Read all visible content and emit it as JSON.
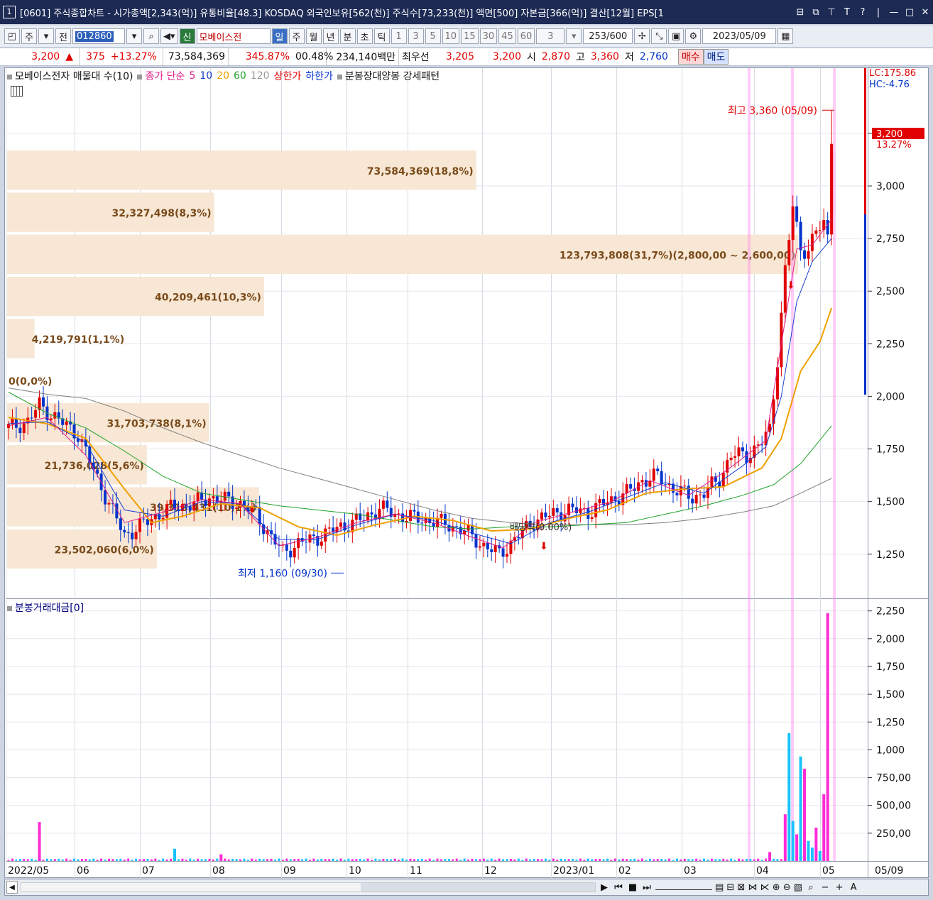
{
  "window": {
    "number": "1",
    "title": "[0601] 주식종합차트 - 시가총액[2,343(억)] 유통비율[48.3] KOSDAQ 외국인보유[562(천)] 주식수[73,233(천)] 액면[500] 자본금[366(억)] 결산[12월] EPS[1",
    "buttons": [
      "⊟",
      "⧉",
      "⊤",
      "T",
      "?",
      "|",
      "—",
      "□",
      "✕"
    ]
  },
  "toolbar": {
    "type_selector": "주",
    "all_label": "전",
    "stock_code": "012860",
    "new_badge": "신",
    "stock_name": "모베이스전",
    "period_tabs": [
      "일",
      "주",
      "월",
      "년",
      "분",
      "초",
      "틱"
    ],
    "minute_options": [
      "1",
      "3",
      "5",
      "10",
      "15",
      "30",
      "45",
      "60"
    ],
    "interval_value": "3",
    "count_display": "253/600",
    "date_value": "2023/05/09"
  },
  "quote": {
    "price": "3,200",
    "arrow": "▲",
    "change": "375",
    "change_pct": "+13.27%",
    "volume": "73,584,369",
    "volume_ratio": "345.87%",
    "turnover": "00.48%",
    "amount": "234,140백만",
    "best_ask_label": "최우선",
    "best_ask": "3,205",
    "best_bid": "3,200",
    "open_label": "시",
    "open": "2,870",
    "high_label": "고",
    "high": "3,360",
    "low_label": "저",
    "low": "2,760",
    "buy_label": "매수",
    "sell_label": "매도"
  },
  "legend": {
    "profile_label": "모베이스전자 매물대 수(10)",
    "ma_label": "종가 단순",
    "ma_periods": [
      "5",
      "10",
      "20",
      "60",
      "120"
    ],
    "upper_limit": "상한가",
    "lower_limit": "하한가",
    "pattern": "분봉장대양봉 강세패턴"
  },
  "colors": {
    "up": "#e00000",
    "down": "#0033cc",
    "ma5": "#e0208a",
    "ma10": "#1a3fcf",
    "ma20": "#f0a000",
    "ma60": "#21a32a",
    "ma120": "#808080",
    "profile": "#f7e7d4",
    "profile_text": "#7a4a1a",
    "vol_up": "#ff2bd6",
    "vol_down": "#19c3ff"
  },
  "side_labels": {
    "lc": "LC:175.86",
    "hc": "HC:-4.76",
    "current_price": "3,200",
    "current_pct": "13.27%"
  },
  "annotations": {
    "high": "최고 3,360 (05/09)",
    "low": "최저 1,160 (09/30)",
    "dividend": "배당락(0.00%)"
  },
  "volume_legend": "분봉거래대금[0]",
  "bottom": {
    "nav_icons": [
      "▶",
      "⏮",
      "■",
      "⏭"
    ],
    "zoom_minus": "−",
    "zoom_plus": "+",
    "font": "A"
  },
  "chart_data": {
    "type": "candlestick",
    "price_axis": {
      "ticks": [
        1250,
        1500,
        1750,
        2000,
        2250,
        2500,
        2750,
        3000,
        3250
      ],
      "tick_labels": [
        "1,250",
        "1,500",
        "1,750",
        "2,000",
        "2,250",
        "2,500",
        "2,750",
        "3,000",
        "3,250"
      ],
      "range": [
        1040,
        3560
      ]
    },
    "volume_axis": {
      "ticks": [
        250,
        500,
        750,
        1000,
        1250,
        1500,
        1750,
        2000,
        2250
      ],
      "tick_labels": [
        "250,00",
        "500,00",
        "750,00",
        "1,000",
        "1,250",
        "1,500",
        "1,750",
        "2,000",
        "2,250"
      ],
      "range": [
        0,
        2350
      ]
    },
    "x_labels": [
      "2022/05",
      "06",
      "07",
      "08",
      "09",
      "10",
      "11",
      "12",
      "2023/01",
      "02",
      "03",
      "04",
      "05",
      "05/09"
    ],
    "volume_profile": [
      {
        "low": 1175,
        "high": 1375,
        "label": "23,502,060(6,0%)",
        "pct": 6.0
      },
      {
        "low": 1375,
        "high": 1575,
        "label": "39,313,431(10,1%)",
        "pct": 10.1
      },
      {
        "low": 1575,
        "high": 1775,
        "label": "21,736,028(5,6%)",
        "pct": 5.6
      },
      {
        "low": 1775,
        "high": 1975,
        "label": "31,703,738(8,1%)",
        "pct": 8.1
      },
      {
        "low": 1975,
        "high": 2175,
        "label": "0(0,0%)",
        "pct": 0
      },
      {
        "low": 2175,
        "high": 2375,
        "label": "4,219,791(1,1%)",
        "pct": 1.1
      },
      {
        "low": 2375,
        "high": 2575,
        "label": "40,209,461(10,3%)",
        "pct": 10.3
      },
      {
        "low": 2575,
        "high": 2775,
        "label": "123,793,808(31,7%)(2,800,00 ~ 2,600,00)",
        "pct": 31.7
      },
      {
        "low": 2775,
        "high": 2975,
        "label": "32,327,498(8,3%)",
        "pct": 8.3
      },
      {
        "low": 2975,
        "high": 3175,
        "label": "73,584,369(18,8%)",
        "pct": 18.8
      }
    ],
    "close_path": [
      [
        0,
        1850
      ],
      [
        5,
        1880
      ],
      [
        8,
        1960
      ],
      [
        12,
        1900
      ],
      [
        18,
        1820
      ],
      [
        22,
        1650
      ],
      [
        26,
        1490
      ],
      [
        30,
        1340
      ],
      [
        34,
        1380
      ],
      [
        37,
        1420
      ],
      [
        42,
        1470
      ],
      [
        48,
        1490
      ],
      [
        52,
        1520
      ],
      [
        55,
        1510
      ],
      [
        60,
        1490
      ],
      [
        64,
        1440
      ],
      [
        68,
        1330
      ],
      [
        71,
        1260
      ],
      [
        75,
        1300
      ],
      [
        80,
        1330
      ],
      [
        86,
        1380
      ],
      [
        92,
        1420
      ],
      [
        96,
        1470
      ],
      [
        100,
        1440
      ],
      [
        105,
        1420
      ],
      [
        109,
        1410
      ],
      [
        114,
        1390
      ],
      [
        118,
        1360
      ],
      [
        123,
        1290
      ],
      [
        127,
        1250
      ],
      [
        131,
        1320
      ],
      [
        136,
        1410
      ],
      [
        141,
        1440
      ],
      [
        145,
        1460
      ],
      [
        150,
        1450
      ],
      [
        155,
        1500
      ],
      [
        160,
        1540
      ],
      [
        164,
        1600
      ],
      [
        168,
        1620
      ],
      [
        172,
        1560
      ],
      [
        177,
        1520
      ],
      [
        180,
        1540
      ],
      [
        184,
        1610
      ],
      [
        187,
        1720
      ],
      [
        191,
        1720
      ],
      [
        195,
        1780
      ],
      [
        197,
        1840
      ],
      [
        199,
        2180
      ],
      [
        201,
        2600
      ],
      [
        203,
        2900
      ],
      [
        205,
        2700
      ],
      [
        207,
        2700
      ],
      [
        209,
        2780
      ],
      [
        211,
        2820
      ],
      [
        212,
        2760
      ],
      [
        213,
        3200
      ]
    ],
    "ma_paths": {
      "ma5": [
        [
          0,
          1860
        ],
        [
          10,
          1900
        ],
        [
          20,
          1720
        ],
        [
          30,
          1400
        ],
        [
          40,
          1450
        ],
        [
          50,
          1510
        ],
        [
          60,
          1490
        ],
        [
          70,
          1290
        ],
        [
          80,
          1330
        ],
        [
          90,
          1400
        ],
        [
          100,
          1440
        ],
        [
          110,
          1400
        ],
        [
          120,
          1330
        ],
        [
          128,
          1280
        ],
        [
          136,
          1400
        ],
        [
          146,
          1450
        ],
        [
          156,
          1500
        ],
        [
          166,
          1600
        ],
        [
          176,
          1530
        ],
        [
          186,
          1650
        ],
        [
          196,
          1790
        ],
        [
          200,
          2250
        ],
        [
          204,
          2700
        ],
        [
          208,
          2720
        ],
        [
          213,
          2840
        ]
      ],
      "ma10": [
        [
          0,
          1870
        ],
        [
          10,
          1880
        ],
        [
          20,
          1780
        ],
        [
          30,
          1460
        ],
        [
          40,
          1430
        ],
        [
          50,
          1500
        ],
        [
          60,
          1490
        ],
        [
          70,
          1320
        ],
        [
          80,
          1320
        ],
        [
          90,
          1390
        ],
        [
          100,
          1440
        ],
        [
          110,
          1410
        ],
        [
          120,
          1350
        ],
        [
          130,
          1300
        ],
        [
          140,
          1400
        ],
        [
          150,
          1450
        ],
        [
          160,
          1520
        ],
        [
          170,
          1590
        ],
        [
          180,
          1540
        ],
        [
          190,
          1670
        ],
        [
          196,
          1760
        ],
        [
          200,
          2000
        ],
        [
          204,
          2450
        ],
        [
          208,
          2640
        ],
        [
          213,
          2750
        ]
      ],
      "ma20": [
        [
          0,
          1900
        ],
        [
          10,
          1870
        ],
        [
          20,
          1800
        ],
        [
          30,
          1560
        ],
        [
          37,
          1400
        ],
        [
          45,
          1430
        ],
        [
          55,
          1490
        ],
        [
          65,
          1470
        ],
        [
          75,
          1380
        ],
        [
          85,
          1340
        ],
        [
          95,
          1390
        ],
        [
          105,
          1430
        ],
        [
          115,
          1410
        ],
        [
          125,
          1360
        ],
        [
          135,
          1370
        ],
        [
          145,
          1420
        ],
        [
          155,
          1460
        ],
        [
          165,
          1540
        ],
        [
          175,
          1560
        ],
        [
          185,
          1570
        ],
        [
          195,
          1660
        ],
        [
          200,
          1800
        ],
        [
          205,
          2120
        ],
        [
          210,
          2260
        ],
        [
          213,
          2420
        ]
      ],
      "ma60": [
        [
          0,
          2020
        ],
        [
          10,
          1920
        ],
        [
          20,
          1850
        ],
        [
          30,
          1740
        ],
        [
          40,
          1620
        ],
        [
          50,
          1540
        ],
        [
          60,
          1510
        ],
        [
          70,
          1480
        ],
        [
          80,
          1460
        ],
        [
          90,
          1440
        ],
        [
          100,
          1410
        ],
        [
          110,
          1380
        ],
        [
          120,
          1370
        ],
        [
          130,
          1380
        ],
        [
          140,
          1380
        ],
        [
          150,
          1390
        ],
        [
          160,
          1400
        ],
        [
          170,
          1440
        ],
        [
          180,
          1480
        ],
        [
          190,
          1530
        ],
        [
          198,
          1580
        ],
        [
          205,
          1680
        ],
        [
          213,
          1860
        ]
      ],
      "ma120": [
        [
          0,
          2040
        ],
        [
          10,
          2010
        ],
        [
          20,
          1990
        ],
        [
          30,
          1930
        ],
        [
          40,
          1850
        ],
        [
          50,
          1780
        ],
        [
          60,
          1720
        ],
        [
          70,
          1660
        ],
        [
          80,
          1610
        ],
        [
          90,
          1560
        ],
        [
          100,
          1510
        ],
        [
          110,
          1460
        ],
        [
          120,
          1420
        ],
        [
          130,
          1400
        ],
        [
          140,
          1390
        ],
        [
          150,
          1390
        ],
        [
          160,
          1390
        ],
        [
          170,
          1400
        ],
        [
          180,
          1420
        ],
        [
          190,
          1450
        ],
        [
          198,
          1480
        ],
        [
          205,
          1540
        ],
        [
          213,
          1610
        ]
      ]
    },
    "volume_spikes": [
      {
        "bar": 8,
        "value": 350,
        "up": true
      },
      {
        "bar": 43,
        "value": 110,
        "up": false
      },
      {
        "bar": 55,
        "value": 60,
        "up": true
      },
      {
        "bar": 197,
        "value": 80,
        "up": true
      },
      {
        "bar": 201,
        "value": 420,
        "up": true
      },
      {
        "bar": 202,
        "value": 1150,
        "up": false
      },
      {
        "bar": 203,
        "value": 360,
        "up": false
      },
      {
        "bar": 204,
        "value": 240,
        "up": true
      },
      {
        "bar": 205,
        "value": 940,
        "up": false
      },
      {
        "bar": 206,
        "value": 830,
        "up": true
      },
      {
        "bar": 207,
        "value": 180,
        "up": false
      },
      {
        "bar": 208,
        "value": 120,
        "up": false
      },
      {
        "bar": 209,
        "value": 300,
        "up": true
      },
      {
        "bar": 210,
        "value": 90,
        "up": false
      },
      {
        "bar": 211,
        "value": 600,
        "up": true
      },
      {
        "bar": 212,
        "value": 2230,
        "up": true
      }
    ]
  }
}
